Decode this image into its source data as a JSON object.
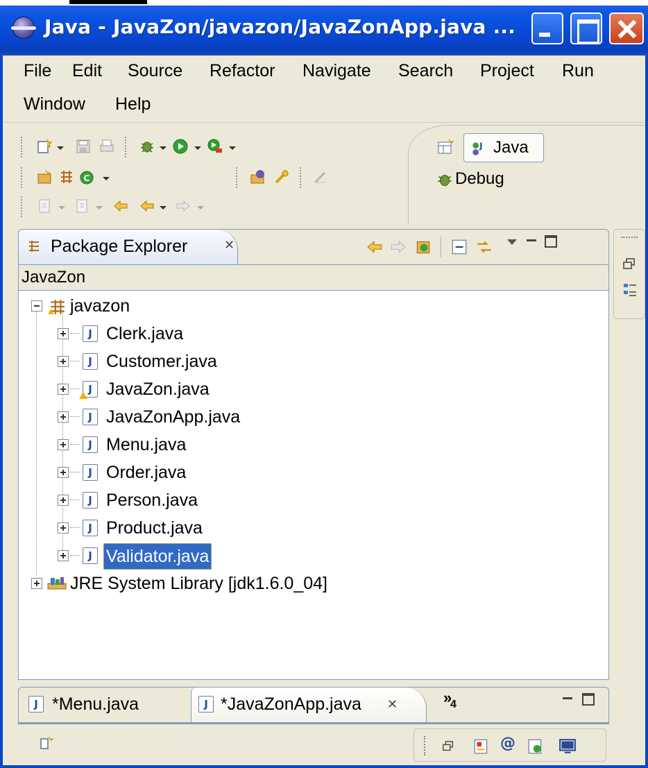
{
  "window": {
    "title": "Java - JavaZon/javazon/JavaZonApp.java ..."
  },
  "menu": {
    "items": [
      {
        "label": "File"
      },
      {
        "label": "Edit"
      },
      {
        "label": "Source"
      },
      {
        "label": "Refactor"
      },
      {
        "label": "Navigate"
      },
      {
        "label": "Search"
      },
      {
        "label": "Project"
      },
      {
        "label": "Run"
      },
      {
        "label": "Window"
      },
      {
        "label": "Help"
      }
    ]
  },
  "perspectives": {
    "java_label": "Java",
    "debug_label": "Debug"
  },
  "package_explorer": {
    "tab_label": "Package Explorer",
    "close_glyph": "✕",
    "breadcrumb": "JavaZon",
    "tree": {
      "package": "javazon",
      "files": [
        {
          "name": "Clerk.java",
          "warning": false
        },
        {
          "name": "Customer.java",
          "warning": false
        },
        {
          "name": "JavaZon.java",
          "warning": true
        },
        {
          "name": "JavaZonApp.java",
          "warning": false
        },
        {
          "name": "Menu.java",
          "warning": false
        },
        {
          "name": "Order.java",
          "warning": false
        },
        {
          "name": "Person.java",
          "warning": false
        },
        {
          "name": "Product.java",
          "warning": false
        },
        {
          "name": "Validator.java",
          "warning": false,
          "selected": true
        }
      ],
      "library": "JRE System Library [jdk1.6.0_04]"
    }
  },
  "editor": {
    "tabs": [
      {
        "label": "*Menu.java",
        "active": false
      },
      {
        "label": "*JavaZonApp.java",
        "active": true
      }
    ],
    "overflow_label": "»",
    "overflow_count": "4",
    "close_glyph": "✕"
  },
  "icons": {
    "java_file_glyph": "J"
  },
  "colors": {
    "titlebar_blue": "#0a55e0",
    "selection_blue": "#316ac5",
    "window_bg": "#ece9d8",
    "warning_yellow": "#f0b000"
  }
}
